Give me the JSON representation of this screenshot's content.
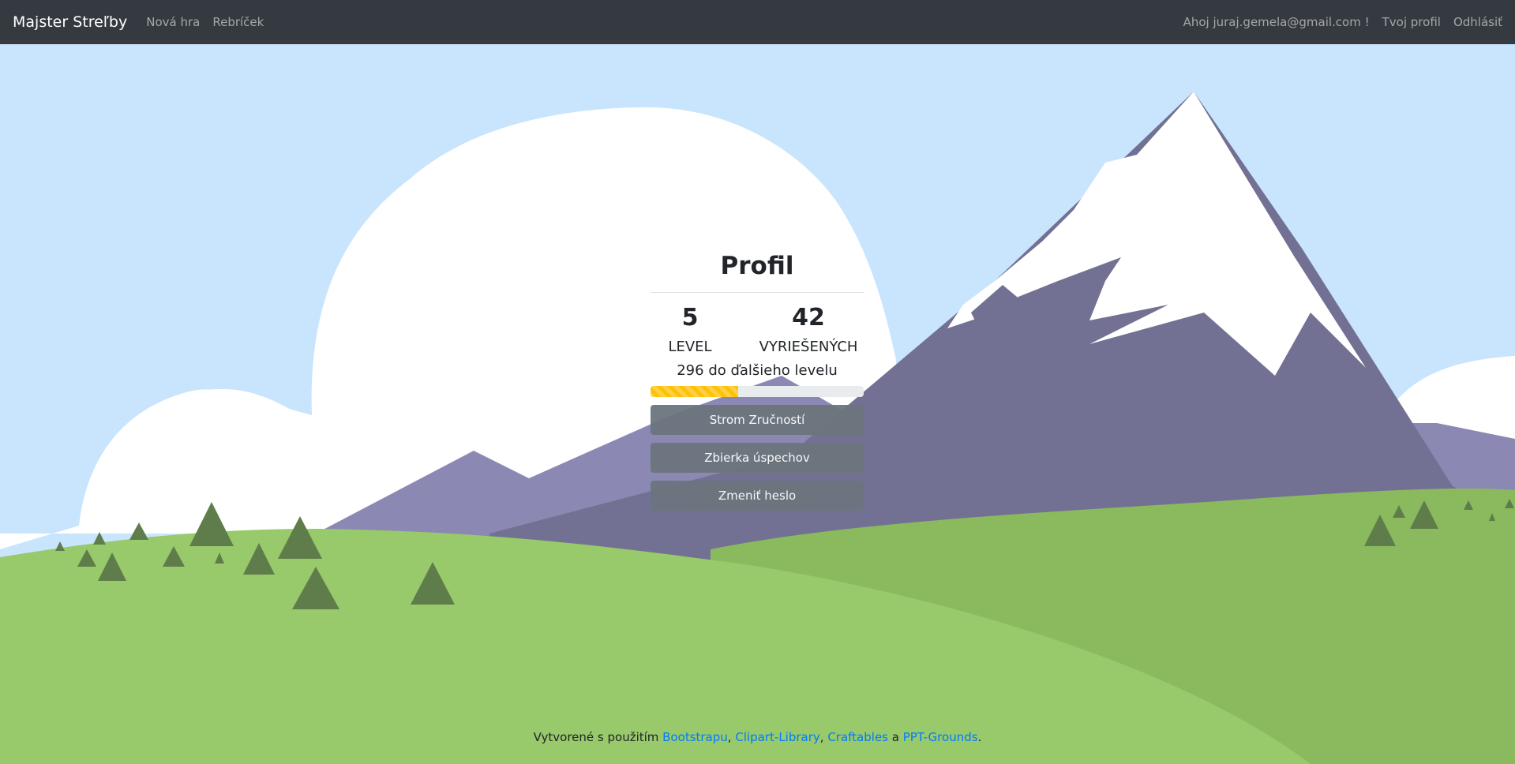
{
  "navbar": {
    "brand": "Majster Streľby",
    "links": [
      "Nová hra",
      "Rebríček"
    ],
    "greeting": "Ahoj juraj.gemela@gmail.com !",
    "profile_link": "Tvoj profil",
    "logout_link": "Odhlásiť"
  },
  "profile": {
    "title": "Profil",
    "level_value": "5",
    "level_label": "LEVEL",
    "solved_value": "42",
    "solved_label": "VYRIEŠENÝCH",
    "next_level_text": "296 do ďalšieho levelu",
    "progress_fraction": 0.41,
    "progress_color": "#ffc107",
    "buttons": [
      "Strom Zručností",
      "Zbierka úspechov",
      "Zmeniť heslo"
    ]
  },
  "footer": {
    "prefix": "Vytvorené s použitím ",
    "links": [
      "Bootstrapu",
      "Clipart-Library",
      "Craftables",
      "PPT-Grounds"
    ],
    "sep1": ", ",
    "sep2": ", ",
    "sep3": " a ",
    "suffix": "."
  },
  "colors": {
    "navbar": "#343a40",
    "sky": "#c9e4fd",
    "mountain_light": "#8b89b3",
    "mountain_dark": "#737193",
    "grass": "#98c96a",
    "grass_dark": "#8aba5d",
    "tree": "#5f7d4a",
    "link": "#007bff"
  }
}
